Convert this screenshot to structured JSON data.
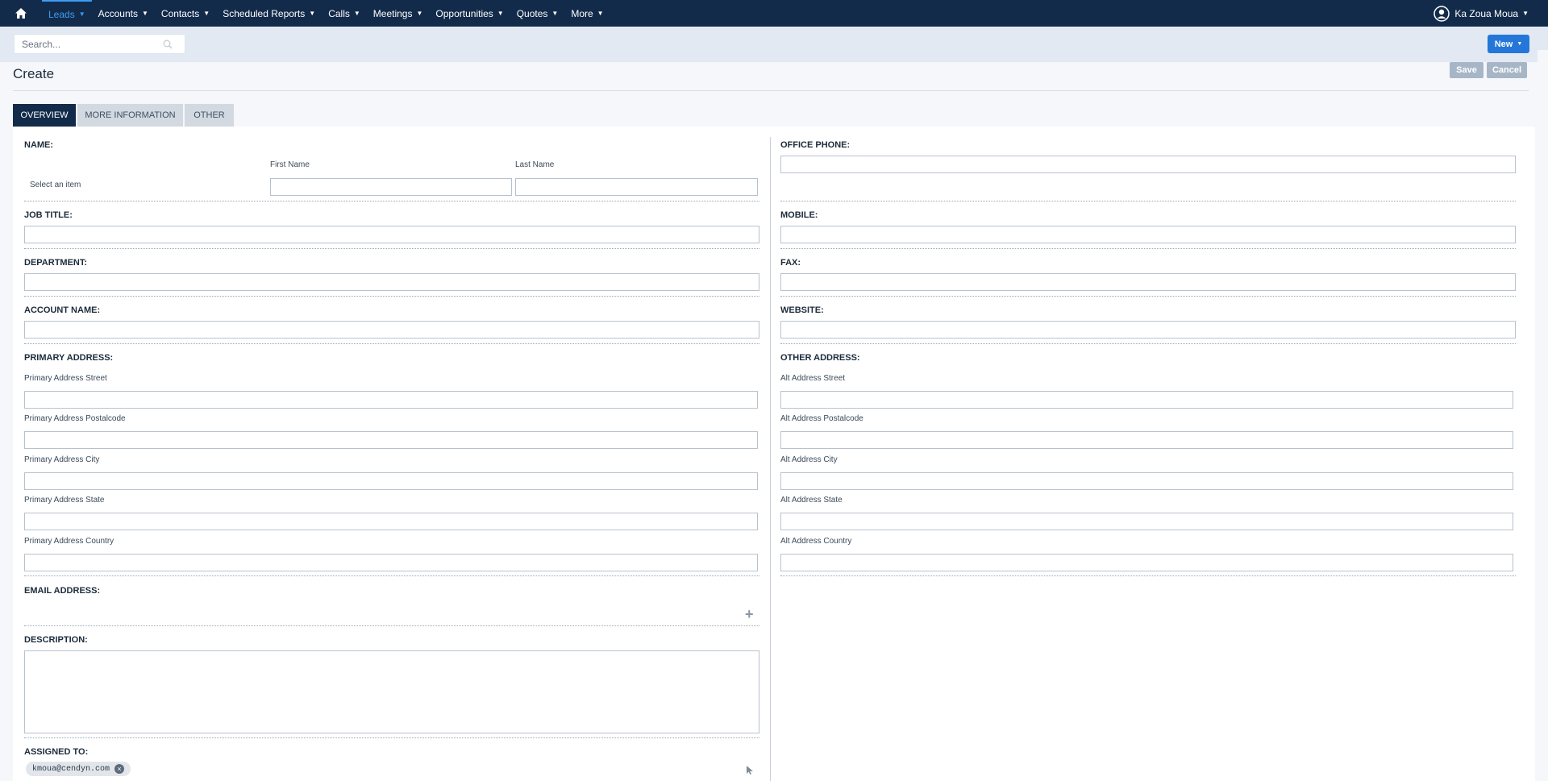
{
  "nav": {
    "items": [
      {
        "label": "Leads",
        "active": true
      },
      {
        "label": "Accounts"
      },
      {
        "label": "Contacts"
      },
      {
        "label": "Scheduled Reports"
      },
      {
        "label": "Calls"
      },
      {
        "label": "Meetings"
      },
      {
        "label": "Opportunities"
      },
      {
        "label": "Quotes"
      },
      {
        "label": "More"
      }
    ],
    "user_name": "Ka Zoua Moua",
    "home_icon": "home-icon",
    "user_icon": "user-circle-icon"
  },
  "search": {
    "placeholder": "Search...",
    "icon": "search-icon"
  },
  "header": {
    "new_label": "New",
    "title": "Create",
    "save_label": "Save",
    "cancel_label": "Cancel"
  },
  "tabs": [
    {
      "label": "OVERVIEW",
      "active": true
    },
    {
      "label": "MORE INFORMATION"
    },
    {
      "label": "OTHER"
    }
  ],
  "form": {
    "name_label": "NAME:",
    "first_name_label": "First Name",
    "last_name_label": "Last Name",
    "salutation_placeholder": "Select an item",
    "job_title_label": "JOB TITLE:",
    "department_label": "DEPARTMENT:",
    "account_name_label": "ACCOUNT NAME:",
    "primary_address_label": "PRIMARY ADDRESS:",
    "primary_street_label": "Primary Address Street",
    "primary_postalcode_label": "Primary Address Postalcode",
    "primary_city_label": "Primary Address City",
    "primary_state_label": "Primary Address State",
    "primary_country_label": "Primary Address Country",
    "email_label": "EMAIL ADDRESS:",
    "description_label": "DESCRIPTION:",
    "assigned_to_label": "ASSIGNED TO:",
    "assigned_to_value": "kmoua@cendyn.com",
    "office_phone_label": "OFFICE PHONE:",
    "mobile_label": "MOBILE:",
    "fax_label": "FAX:",
    "website_label": "WEBSITE:",
    "other_address_label": "OTHER ADDRESS:",
    "alt_street_label": "Alt Address Street",
    "alt_postalcode_label": "Alt Address Postalcode",
    "alt_city_label": "Alt Address City",
    "alt_state_label": "Alt Address State",
    "alt_country_label": "Alt Address Country"
  },
  "colors": {
    "nav_bg": "#132b4a",
    "accent": "#3b9cf6",
    "button_blue": "#2477d8"
  }
}
